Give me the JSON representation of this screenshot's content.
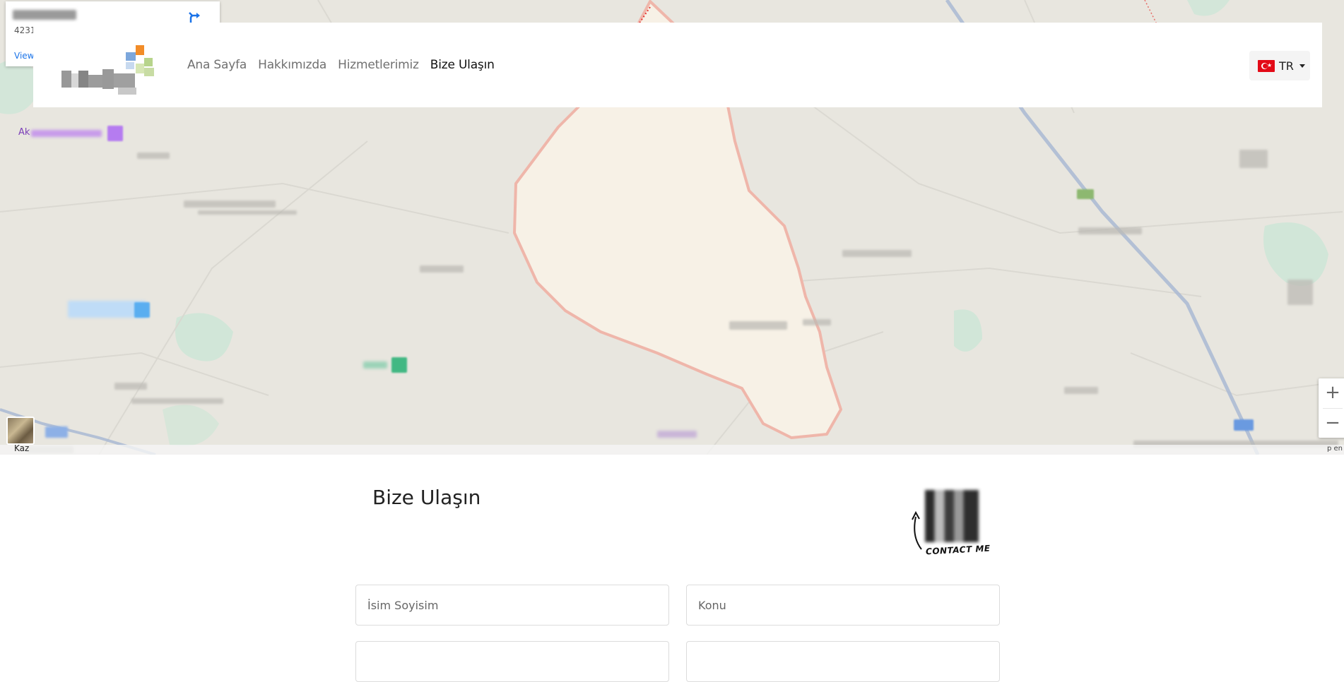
{
  "map": {
    "info_card": {
      "place_sub": "4231",
      "view_link": "View"
    },
    "overlay_labels": {
      "left_label": "Ak"
    },
    "bottom_left_label": "Kaz",
    "attribution": "p en",
    "zoom": {
      "in": "+",
      "out": "−"
    }
  },
  "navbar": {
    "links": [
      {
        "label": "Ana Sayfa",
        "active": false
      },
      {
        "label": "Hakkımızda",
        "active": false
      },
      {
        "label": "Hizmetlerimiz",
        "active": false
      },
      {
        "label": "Bize Ulaşın",
        "active": true
      }
    ],
    "language": {
      "code": "TR",
      "flag_icon": "turkey-flag-icon"
    }
  },
  "contact": {
    "title": "Bize Ulaşın",
    "qr_caption": "CONTACT ME",
    "fields": {
      "name_placeholder": "İsim Soyisim",
      "subject_placeholder": "Konu"
    }
  },
  "colors": {
    "region_fill": "#f7f1e6",
    "region_border": "#f0b9ae",
    "link_blue": "#1a73e8",
    "flag_red": "#e30a17"
  }
}
